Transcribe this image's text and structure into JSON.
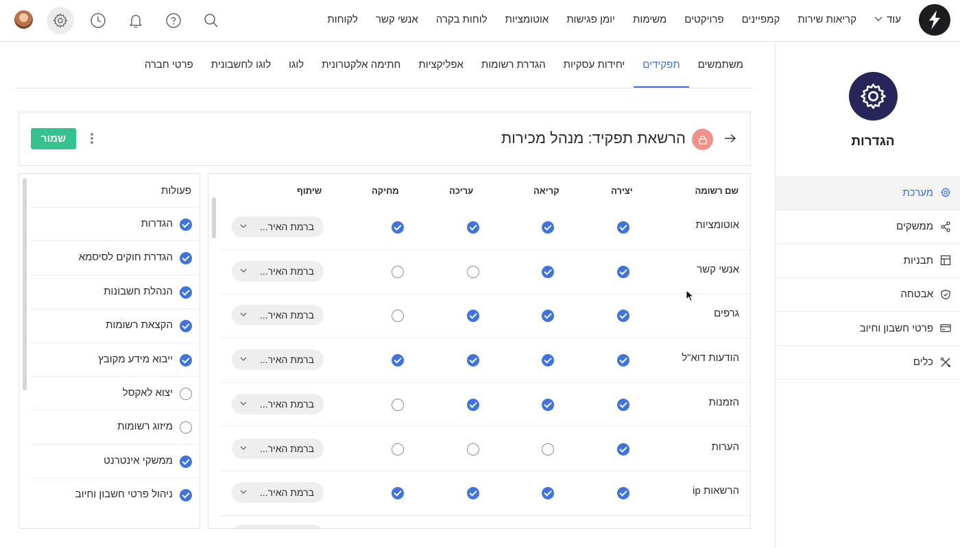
{
  "topbar": {
    "nav": [
      "לקוחות",
      "אנשי קשר",
      "לוחות בקרה",
      "אוטומציות",
      "יומן פגישות",
      "משימות",
      "פרויקטים",
      "קמפיינים",
      "קריאות שירות"
    ],
    "more_label": "עוד",
    "icons": [
      "search-icon",
      "help-icon",
      "bell-icon",
      "clock-icon",
      "settings-icon",
      "avatar"
    ]
  },
  "sidebar": {
    "title": "הגדרות",
    "items": [
      {
        "label": "מערכת",
        "icon": "gear-icon",
        "active": true
      },
      {
        "label": "ממשקים",
        "icon": "share-nodes-icon",
        "active": false
      },
      {
        "label": "תבניות",
        "icon": "layout-icon",
        "active": false
      },
      {
        "label": "אבטחה",
        "icon": "shield-icon",
        "active": false
      },
      {
        "label": "פרטי חשבון וחיוב",
        "icon": "credit-card-icon",
        "active": false
      },
      {
        "label": "כלים",
        "icon": "tools-icon",
        "active": false
      }
    ]
  },
  "tabs": [
    {
      "label": "משתמשים",
      "active": false
    },
    {
      "label": "תפקידים",
      "active": true
    },
    {
      "label": "יחידות עסקיות",
      "active": false
    },
    {
      "label": "הגדרת רשומות",
      "active": false
    },
    {
      "label": "אפליקציות",
      "active": false
    },
    {
      "label": "חתימה אלקטרונית",
      "active": false
    },
    {
      "label": "לוגו",
      "active": false
    },
    {
      "label": "לוגו לחשבונית",
      "active": false
    },
    {
      "label": "פרטי חברה",
      "active": false
    }
  ],
  "header": {
    "title": "הרשאת תפקיד: מנהל מכירות",
    "save_label": "שמור"
  },
  "permissions": {
    "columns": {
      "name": "שם רשומה",
      "create": "יצירה",
      "read": "קריאה",
      "edit": "עריכה",
      "delete": "מחיקה",
      "share": "שיתוף"
    },
    "share_value": "ברמת האיר...",
    "rows": [
      {
        "name": "אוטומציות",
        "create": true,
        "read": true,
        "edit": true,
        "delete": true
      },
      {
        "name": "אנשי קשר",
        "create": true,
        "read": true,
        "edit": false,
        "delete": false
      },
      {
        "name": "גרפים",
        "create": true,
        "read": true,
        "edit": true,
        "delete": false
      },
      {
        "name": "הודעות דוא\"ל",
        "create": true,
        "read": true,
        "edit": true,
        "delete": true
      },
      {
        "name": "הזמנות",
        "create": true,
        "read": true,
        "edit": true,
        "delete": false
      },
      {
        "name": "הערות",
        "create": true,
        "read": false,
        "edit": false,
        "delete": false
      },
      {
        "name": "הרשאות ip",
        "create": true,
        "read": true,
        "edit": true,
        "delete": true
      }
    ]
  },
  "actions": {
    "header": "פעולות",
    "items": [
      {
        "label": "הגדרות",
        "checked": true
      },
      {
        "label": "הגדרת חוקים לסיסמא",
        "checked": true
      },
      {
        "label": "הנהלת חשבונות",
        "checked": true
      },
      {
        "label": "הקצאת רשומות",
        "checked": true
      },
      {
        "label": "ייבוא מידע מקובץ",
        "checked": true
      },
      {
        "label": "יצוא לאקסל",
        "checked": false
      },
      {
        "label": "מיזוג רשומות",
        "checked": false
      },
      {
        "label": "ממשקי אינטרנט",
        "checked": true
      },
      {
        "label": "ניהול פרטי חשבון וחיוב",
        "checked": true
      }
    ]
  },
  "colors": {
    "accent": "#3a6fd8",
    "check": "#3f74df",
    "save": "#35c28f",
    "brand_circle": "#27265a",
    "lock_badge": "#f0928a"
  }
}
